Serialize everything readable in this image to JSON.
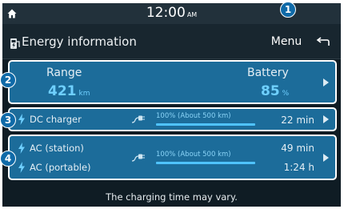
{
  "status_bar": {
    "time": "12:00",
    "ampm": "AM",
    "home_icon": "home-icon"
  },
  "title_bar": {
    "title": "Energy information",
    "title_icon": "ev-charging-icon",
    "menu_label": "Menu",
    "back_icon": "back-arrow-icon"
  },
  "range_card": {
    "range_label": "Range",
    "range_value": "421",
    "range_unit": "km",
    "battery_label": "Battery",
    "battery_value": "85",
    "battery_unit": "%"
  },
  "dc_card": {
    "label": "DC charger",
    "target": "100% (About 500 km)",
    "time": "22 min"
  },
  "ac_card": {
    "station_label": "AC (station)",
    "portable_label": "AC (portable)",
    "target": "100% (About 500 km)",
    "station_time": "49 min",
    "portable_time": "1:24 h"
  },
  "footer": "The charging time may vary.",
  "callouts": [
    "1",
    "2",
    "3",
    "4"
  ]
}
